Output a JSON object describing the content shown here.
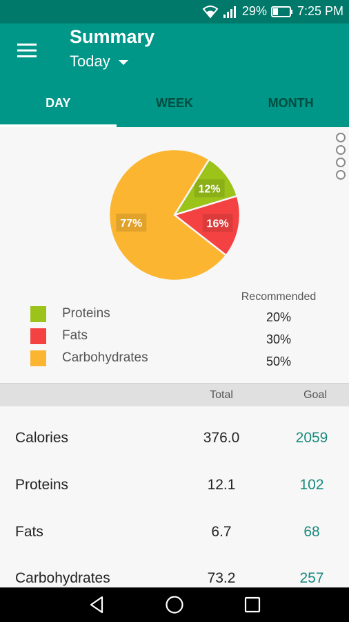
{
  "status_bar": {
    "battery_percent": "29%",
    "time": "7:25 PM",
    "icons": [
      "wifi-icon",
      "signal-icon",
      "battery-icon"
    ]
  },
  "app_bar": {
    "title": "Summary",
    "period_selector": "Today"
  },
  "tabs": [
    {
      "label": "DAY",
      "active": true
    },
    {
      "label": "WEEK",
      "active": false
    },
    {
      "label": "MONTH",
      "active": false
    }
  ],
  "chart_data": {
    "type": "pie",
    "series": [
      {
        "name": "Proteins",
        "value": 12,
        "label": "12%",
        "color": "#9bc319"
      },
      {
        "name": "Fats",
        "value": 16,
        "label": "16%",
        "color": "#f44242"
      },
      {
        "name": "Carbohydrates",
        "value": 77,
        "label": "77%",
        "color": "#fbb531"
      }
    ]
  },
  "legend": {
    "items": [
      {
        "label": "Proteins",
        "color": "#9bc319"
      },
      {
        "label": "Fats",
        "color": "#f44242"
      },
      {
        "label": "Carbohydrates",
        "color": "#fbb531"
      }
    ],
    "recommended_heading": "Recommended",
    "recommended": [
      "20%",
      "30%",
      "50%"
    ]
  },
  "table": {
    "headers": {
      "total": "Total",
      "goal": "Goal"
    },
    "rows": [
      {
        "name": "Calories",
        "total": "376.0",
        "goal": "2059"
      },
      {
        "name": "Proteins",
        "total": "12.1",
        "goal": "102"
      },
      {
        "name": "Fats",
        "total": "6.7",
        "goal": "68"
      },
      {
        "name": "Carbohydrates",
        "total": "73.2",
        "goal": "257"
      }
    ]
  },
  "colors": {
    "primary": "#009688",
    "primary_dark": "#00796b",
    "goal_text": "#16897c"
  }
}
